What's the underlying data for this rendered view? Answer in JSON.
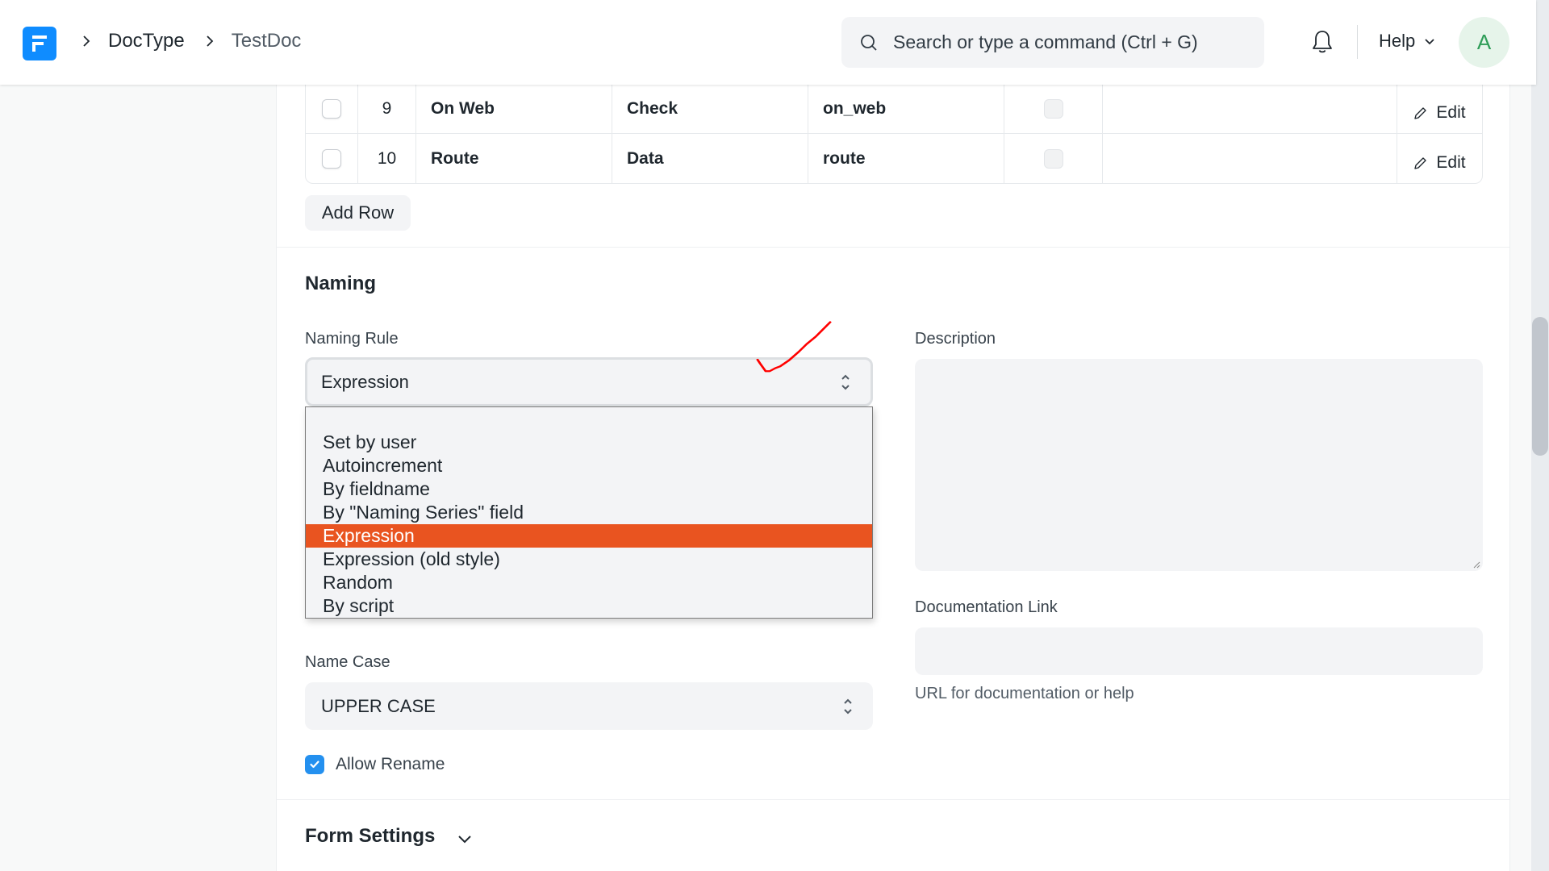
{
  "navbar": {
    "logo_letter": "F",
    "breadcrumbs": [
      "DocType",
      "TestDoc"
    ],
    "search_placeholder": "Search or type a command (Ctrl + G)",
    "help_label": "Help",
    "avatar_initial": "A"
  },
  "fields_table": {
    "rows": [
      {
        "idx": "9",
        "label": "On Web",
        "type": "Check",
        "name": "on_web",
        "mandatory": false,
        "action": "Edit"
      },
      {
        "idx": "10",
        "label": "Route",
        "type": "Data",
        "name": "route",
        "mandatory": false,
        "action": "Edit"
      }
    ],
    "add_row_label": "Add Row"
  },
  "naming": {
    "title": "Naming",
    "naming_rule": {
      "label": "Naming Rule",
      "value": "Expression",
      "options": [
        "",
        "Set by user",
        "Autoincrement",
        "By fieldname",
        "By \"Naming Series\" field",
        "Expression",
        "Expression (old style)",
        "Random",
        "By script"
      ],
      "highlighted": "Expression"
    },
    "description": {
      "label": "Description",
      "value": ""
    },
    "documentation_link": {
      "label": "Documentation Link",
      "value": "",
      "help": "URL for documentation or help"
    },
    "name_case": {
      "label": "Name Case",
      "value": "UPPER CASE"
    },
    "allow_rename": {
      "label": "Allow Rename",
      "checked": true
    }
  },
  "form_settings": {
    "title": "Form Settings",
    "collapsed": true
  },
  "colors": {
    "brand": "#0f8cff",
    "highlight": "#e95420",
    "checkbox": "#2490ef",
    "annotation": "#ff0000"
  }
}
